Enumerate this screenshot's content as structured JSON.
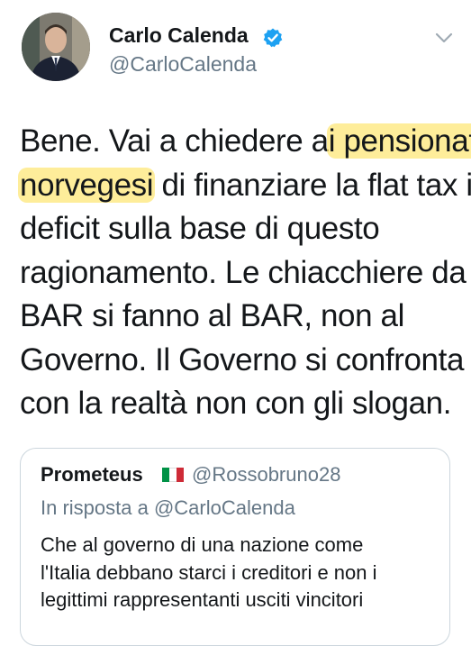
{
  "tweet": {
    "author": {
      "name": "Carlo Calenda",
      "handle": "@CarloCalenda",
      "verified": true
    },
    "text_lines": [
      [
        "Bene. Vai a chiedere a",
        "i pensionati"
      ],
      [
        "norvegesi",
        " di finanziare la flat tax in"
      ],
      [
        "deficit sulla base di questo"
      ],
      [
        "ragionamento. Le chiacchiere da"
      ],
      [
        "BAR si fanno al BAR, non al"
      ],
      [
        "Governo. Il Governo si confronta"
      ],
      [
        "con la realtà non con gli slogan."
      ]
    ],
    "highlight_color": "#fde778"
  },
  "quoted_tweet": {
    "author_name": "Prometeus",
    "flag": "italy-flag-icon",
    "author_handle": "@Rossobruno28",
    "reply_to": "In risposta a @CarloCalenda",
    "text_lines": [
      "Che al governo di una nazione come",
      "l'Italia debbano starci i creditori e non i",
      "legittimi rappresentanti usciti vincitori"
    ]
  },
  "colors": {
    "text": "#14171a",
    "secondary": "#657786",
    "verified": "#1da1f2",
    "border": "#ccd6dd"
  }
}
